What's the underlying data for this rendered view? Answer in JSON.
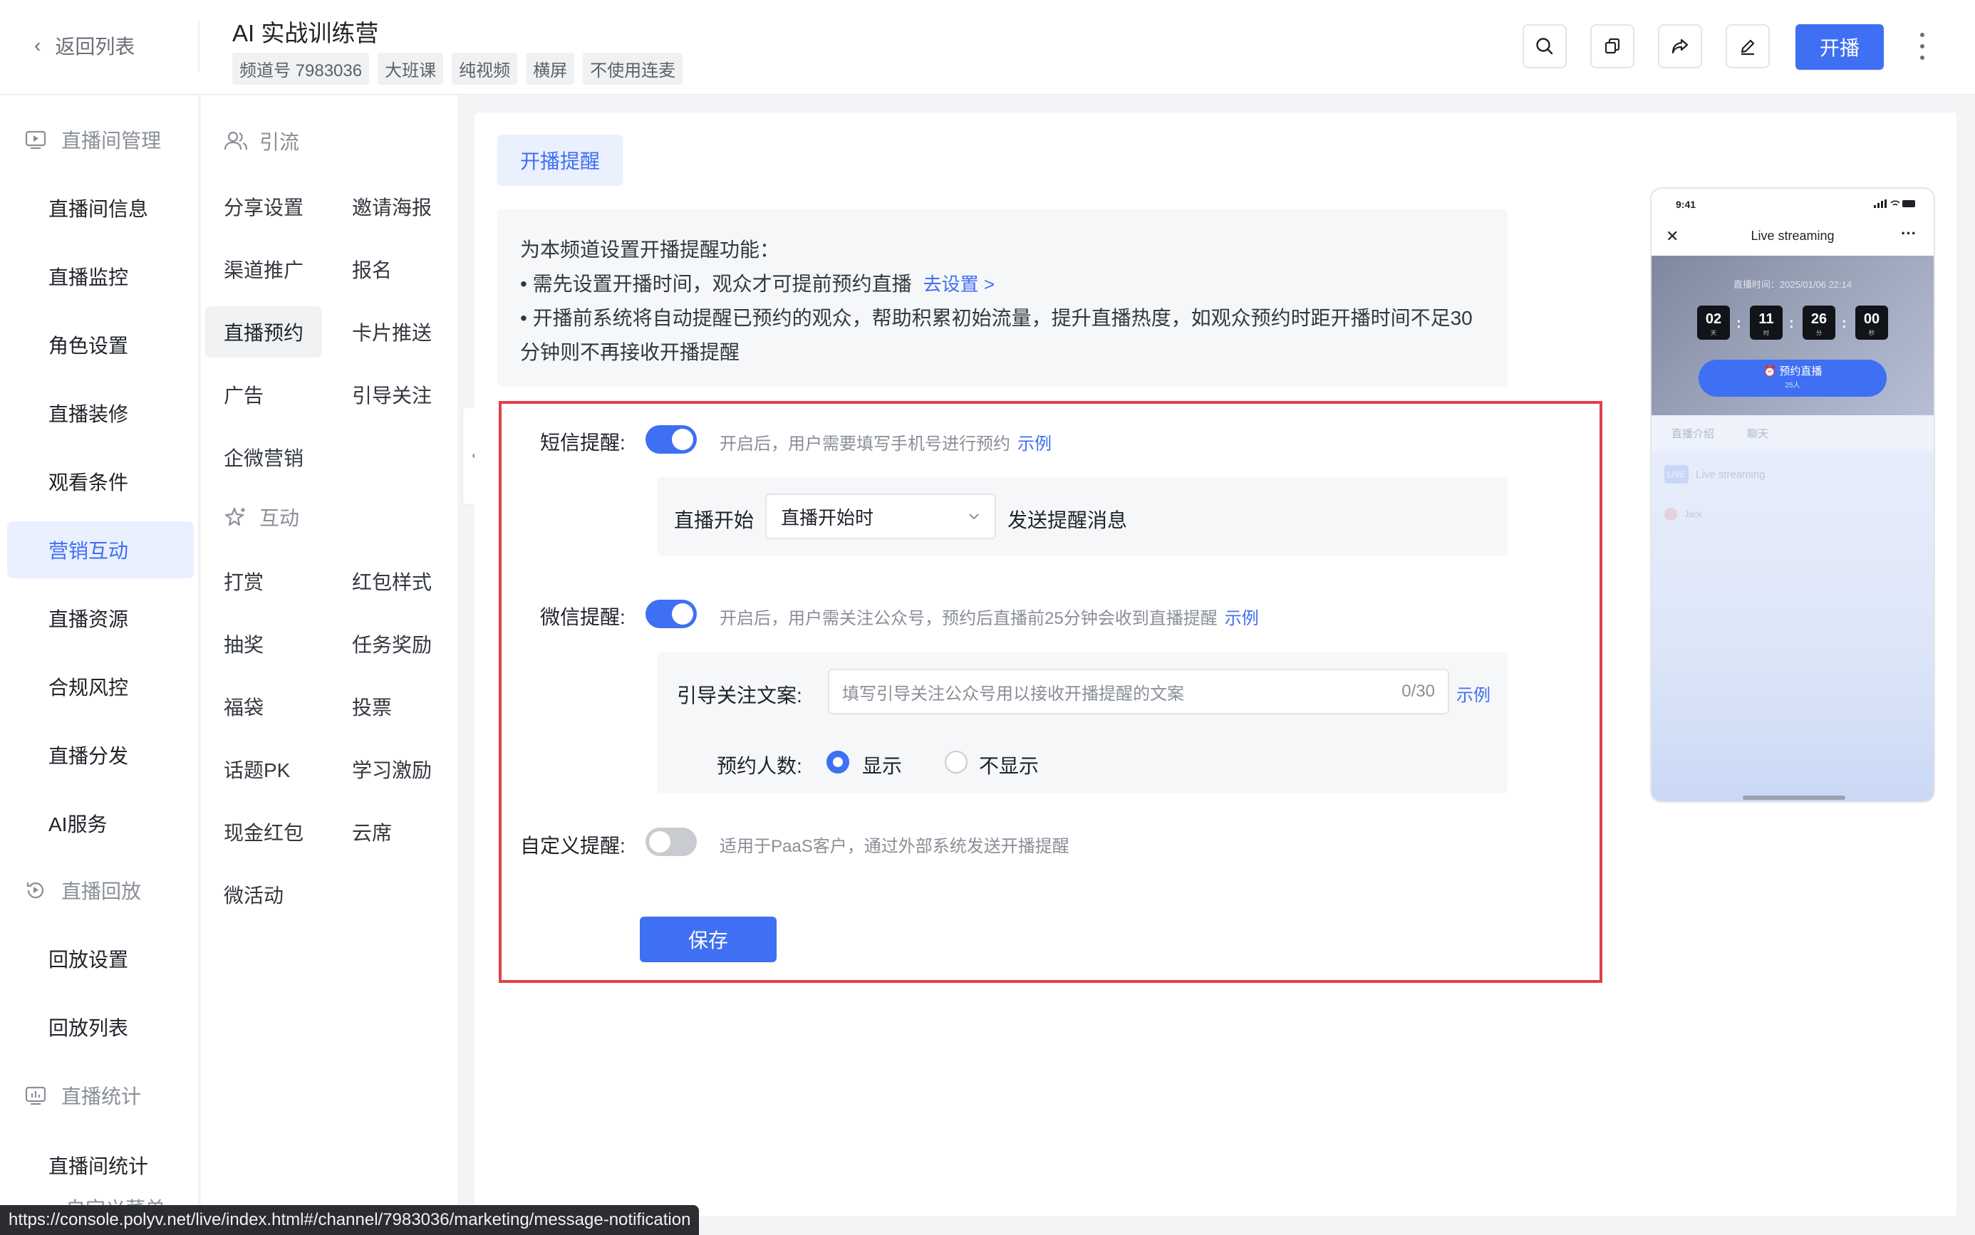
{
  "header": {
    "back_label": "返回列表",
    "title": "AI 实战训练营",
    "tags": [
      "频道号 7983036",
      "大班课",
      "纯视频",
      "横屏",
      "不使用连麦"
    ],
    "start_label": "开播"
  },
  "nav": {
    "groups": {
      "live_manage": "直播间管理",
      "playback": "直播回放",
      "stats": "直播统计"
    },
    "items": {
      "info": "直播间信息",
      "monitor": "直播监控",
      "roles": "角色设置",
      "decor": "直播装修",
      "conditions": "观看条件",
      "marketing": "营销互动",
      "resources": "直播资源",
      "compliance": "合规风控",
      "distribution": "直播分发",
      "ai": "AI服务",
      "playback_settings": "回放设置",
      "playback_list": "回放列表",
      "room_stats": "直播间统计",
      "custom_menu": "自定义菜单"
    }
  },
  "subnav": {
    "group_traffic": "引流",
    "group_interact": "互动",
    "traffic": [
      "分享设置",
      "邀请海报",
      "渠道推广",
      "报名",
      "直播预约",
      "卡片推送",
      "广告",
      "引导关注",
      "企微营销"
    ],
    "interact": [
      "打赏",
      "红包样式",
      "抽奖",
      "任务奖励",
      "福袋",
      "投票",
      "话题PK",
      "学习激励",
      "现金红包",
      "云席",
      "微活动"
    ]
  },
  "main": {
    "tab_label": "开播提醒",
    "intro": {
      "line1": "为本频道设置开播提醒功能：",
      "line2": "• 需先设置开播时间，观众才可提前预约直播",
      "line2_link": "去设置 >",
      "line3": "• 开播前系统将自动提醒已预约的观众，帮助积累初始流量，提升直播热度，如观众预约时距开播时间不足30",
      "line4": "分钟则不再接收开播提醒"
    },
    "sms": {
      "label": "短信提醒:",
      "enabled": true,
      "hint": "开启后，用户需要填写手机号进行预约",
      "example": "示例",
      "prefix": "直播开始",
      "select_value": "直播开始时",
      "suffix": "发送提醒消息"
    },
    "wechat": {
      "label": "微信提醒:",
      "enabled": true,
      "hint": "开启后，用户需关注公众号，预约后直播前25分钟会收到直播提醒",
      "example": "示例",
      "copy_label": "引导关注文案:",
      "copy_placeholder": "填写引导关注公众号用以接收开播提醒的文案",
      "copy_counter": "0/30",
      "copy_example": "示例",
      "count_label": "预约人数:",
      "count_options": [
        "显示",
        "不显示"
      ],
      "count_selected": "显示"
    },
    "custom": {
      "label": "自定义提醒:",
      "enabled": false,
      "hint": "适用于PaaS客户，通过外部系统发送开播提醒"
    },
    "save_label": "保存"
  },
  "preview": {
    "status_time": "9:41",
    "nav_title": "Live streaming",
    "live_time": "直播时间：2025/01/06 22:14",
    "countdown": [
      {
        "value": "02",
        "unit": "天"
      },
      {
        "value": "11",
        "unit": "时"
      },
      {
        "value": "26",
        "unit": "分"
      },
      {
        "value": "00",
        "unit": "秒"
      }
    ],
    "book_label": "预约直播",
    "book_count": "25人",
    "tabs": [
      "直播介绍",
      "聊天"
    ],
    "live_badge": "LIVE",
    "live_title": "Live streaming",
    "user_name": "Jack"
  },
  "status_url": "https://console.polyv.net/live/index.html#/channel/7983036/marketing/message-notification",
  "colors": {
    "accent": "#3f6ff2",
    "highlight_border": "#e0404a"
  }
}
